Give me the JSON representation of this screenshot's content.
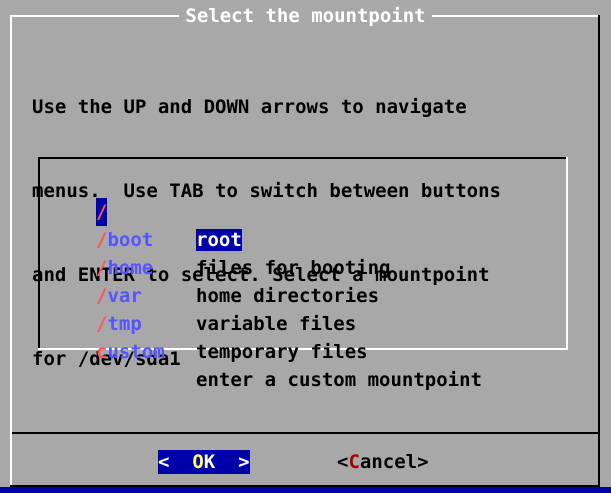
{
  "dialog": {
    "title": "Select the mountpoint",
    "description": [
      "Use the UP and DOWN arrows to navigate",
      "menus.  Use TAB to switch between buttons",
      "and ENTER to select. Select a mountpoint",
      "for /dev/sda1"
    ]
  },
  "menu": {
    "items": [
      {
        "tag_first": "/",
        "tag_rest": "",
        "label": "root",
        "selected": true
      },
      {
        "tag_first": "/",
        "tag_rest": "boot",
        "label": "files for booting",
        "selected": false
      },
      {
        "tag_first": "/",
        "tag_rest": "home",
        "label": "home directories",
        "selected": false
      },
      {
        "tag_first": "/",
        "tag_rest": "var",
        "label": "variable files",
        "selected": false
      },
      {
        "tag_first": "/",
        "tag_rest": "tmp",
        "label": "temporary files",
        "selected": false
      },
      {
        "tag_first": "c",
        "tag_rest": "ustom",
        "label": "enter a custom mountpoint",
        "selected": false
      }
    ]
  },
  "buttons": {
    "ok": {
      "left": "<  ",
      "hot": "O",
      "rest": "K",
      "right": "  >"
    },
    "cancel": {
      "left": "<",
      "hot": "C",
      "rest": "ancel",
      "right": ">"
    }
  },
  "colors": {
    "background": "#0000a8",
    "dialog": "#a8a8a8",
    "tag": "#5555ff",
    "tag_hotkey": "#ff5555",
    "ok_hotkey": "#ffff55",
    "cancel_hotkey": "#aa0000"
  }
}
